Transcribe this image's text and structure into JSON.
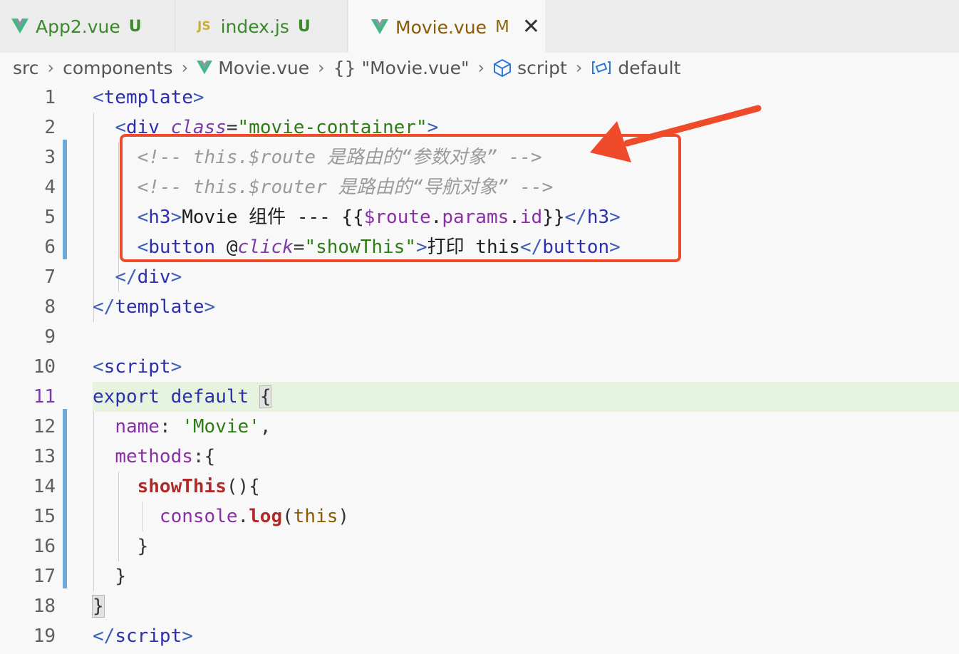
{
  "tabs": [
    {
      "label": "App2.vue",
      "status": "U",
      "icon": "vue-icon"
    },
    {
      "label": "index.js",
      "status": "U",
      "icon": "js-icon",
      "icon_text": "JS"
    },
    {
      "label": "Movie.vue",
      "status": "M",
      "icon": "vue-icon",
      "active": true,
      "close": "✕"
    }
  ],
  "breadcrumb": {
    "items": [
      "src",
      "components",
      "Movie.vue",
      "\"Movie.vue\"",
      "script",
      "default"
    ],
    "sep": "›",
    "obj_icon": "{}"
  },
  "colors": {
    "annotation": "#ef4a2a",
    "vue_green": "#41b883",
    "modified_bar": "#6ea9dd"
  },
  "editor": {
    "active_line": "11",
    "lines": [
      {
        "n": "1",
        "tokens": [
          [
            "c-tag",
            "<"
          ],
          [
            "c-name",
            "template"
          ],
          [
            "c-tag",
            ">"
          ]
        ]
      },
      {
        "n": "2",
        "tokens": [
          [
            "c-txt",
            "  "
          ],
          [
            "c-tag",
            "<"
          ],
          [
            "c-name",
            "div"
          ],
          [
            "c-txt",
            " "
          ],
          [
            "c-attr",
            "class"
          ],
          [
            "c-punc",
            "="
          ],
          [
            "c-str",
            "\"movie-container\""
          ],
          [
            "c-tag",
            ">"
          ]
        ]
      },
      {
        "n": "3",
        "tokens": [
          [
            "c-txt",
            "    "
          ],
          [
            "c-cmt",
            "<!-- this.$route 是路由的“参数对象” -->"
          ]
        ]
      },
      {
        "n": "4",
        "tokens": [
          [
            "c-txt",
            "    "
          ],
          [
            "c-cmt",
            "<!-- this.$router 是路由的“导航对象” -->"
          ]
        ]
      },
      {
        "n": "5",
        "tokens": [
          [
            "c-txt",
            "    "
          ],
          [
            "c-tag",
            "<"
          ],
          [
            "c-name",
            "h3"
          ],
          [
            "c-tag",
            ">"
          ],
          [
            "c-txt",
            "Movie 组件 --- {{"
          ],
          [
            "c-var",
            "$route"
          ],
          [
            "c-txt",
            "."
          ],
          [
            "c-var",
            "params"
          ],
          [
            "c-txt",
            "."
          ],
          [
            "c-var",
            "id"
          ],
          [
            "c-txt",
            "}}"
          ],
          [
            "c-tag",
            "</"
          ],
          [
            "c-name",
            "h3"
          ],
          [
            "c-tag",
            ">"
          ]
        ]
      },
      {
        "n": "6",
        "tokens": [
          [
            "c-txt",
            "    "
          ],
          [
            "c-tag",
            "<"
          ],
          [
            "c-name",
            "button"
          ],
          [
            "c-txt",
            " @"
          ],
          [
            "c-attr",
            "click"
          ],
          [
            "c-punc",
            "="
          ],
          [
            "c-str",
            "\"showThis\""
          ],
          [
            "c-tag",
            ">"
          ],
          [
            "c-txt",
            "打印 this"
          ],
          [
            "c-tag",
            "</"
          ],
          [
            "c-name",
            "button"
          ],
          [
            "c-tag",
            ">"
          ]
        ]
      },
      {
        "n": "7",
        "tokens": [
          [
            "c-txt",
            "  "
          ],
          [
            "c-tag",
            "</"
          ],
          [
            "c-name",
            "div"
          ],
          [
            "c-tag",
            ">"
          ]
        ]
      },
      {
        "n": "8",
        "tokens": [
          [
            "c-tag",
            "</"
          ],
          [
            "c-name",
            "template"
          ],
          [
            "c-tag",
            ">"
          ]
        ]
      },
      {
        "n": "9",
        "tokens": []
      },
      {
        "n": "10",
        "tokens": [
          [
            "c-tag",
            "<"
          ],
          [
            "c-name",
            "script"
          ],
          [
            "c-tag",
            ">"
          ]
        ]
      },
      {
        "n": "11",
        "tokens": [
          [
            "c-kw",
            "export"
          ],
          [
            "c-txt",
            " "
          ],
          [
            "c-kw",
            "default"
          ],
          [
            "c-txt",
            " "
          ],
          [
            "brace",
            "{"
          ]
        ]
      },
      {
        "n": "12",
        "tokens": [
          [
            "c-txt",
            "  "
          ],
          [
            "c-prop",
            "name"
          ],
          [
            "c-punc",
            ": "
          ],
          [
            "c-str",
            "'Movie'"
          ],
          [
            "c-punc",
            ","
          ]
        ]
      },
      {
        "n": "13",
        "tokens": [
          [
            "c-txt",
            "  "
          ],
          [
            "c-prop",
            "methods"
          ],
          [
            "c-punc",
            ":{"
          ]
        ]
      },
      {
        "n": "14",
        "tokens": [
          [
            "c-txt",
            "    "
          ],
          [
            "c-fn",
            "showThis"
          ],
          [
            "c-punc",
            "(){"
          ]
        ]
      },
      {
        "n": "15",
        "tokens": [
          [
            "c-txt",
            "      "
          ],
          [
            "c-prop",
            "console"
          ],
          [
            "c-punc",
            "."
          ],
          [
            "c-fn",
            "log"
          ],
          [
            "c-punc",
            "("
          ],
          [
            "c-this",
            "this"
          ],
          [
            "c-punc",
            ")"
          ]
        ]
      },
      {
        "n": "16",
        "tokens": [
          [
            "c-txt",
            "    "
          ],
          [
            "c-punc",
            "}"
          ]
        ]
      },
      {
        "n": "17",
        "tokens": [
          [
            "c-txt",
            "  "
          ],
          [
            "c-punc",
            "}"
          ]
        ]
      },
      {
        "n": "18",
        "tokens": [
          [
            "brace",
            "}"
          ]
        ]
      },
      {
        "n": "19",
        "tokens": [
          [
            "c-tag",
            "</"
          ],
          [
            "c-name",
            "script"
          ],
          [
            "c-tag",
            ">"
          ]
        ]
      }
    ]
  }
}
